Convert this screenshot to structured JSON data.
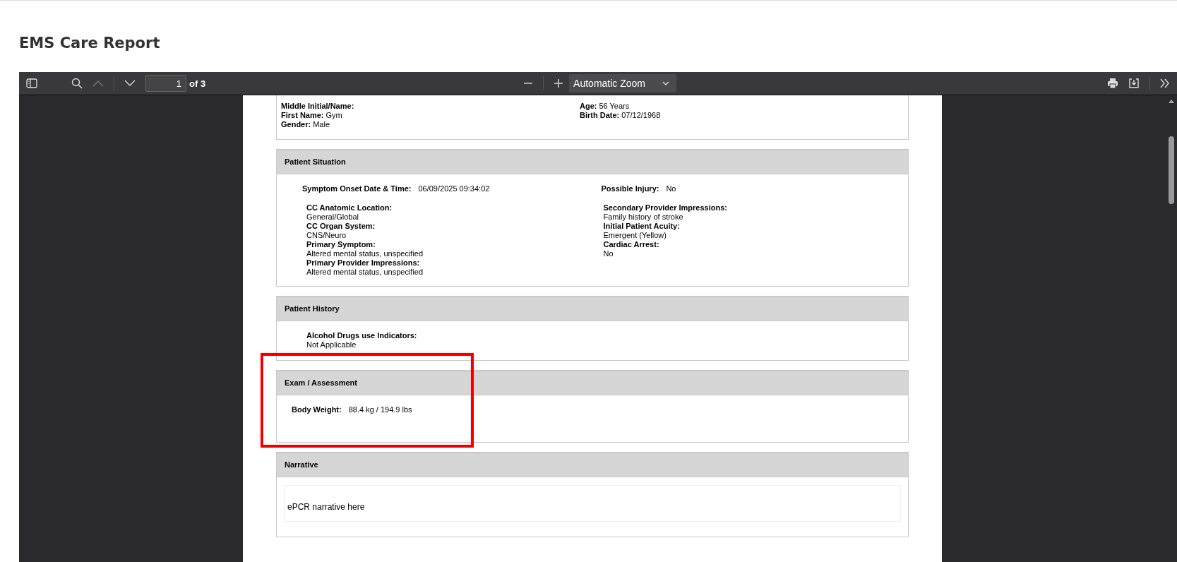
{
  "page_title": "EMS Care Report",
  "toolbar": {
    "page_number": "1",
    "page_count": "of 3",
    "zoom": "Automatic Zoom"
  },
  "demographics": {
    "left": [
      {
        "label": "Middle Initial/Name:"
      },
      {
        "label": "First Name:",
        "value": "Gym"
      },
      {
        "label": "Gender:",
        "value": "Male"
      }
    ],
    "right": [
      {
        "label": "Age:",
        "value": "56 Years"
      },
      {
        "label": "Birth Date:",
        "value": "07/12/1968"
      }
    ]
  },
  "sections": [
    {
      "title": "Patient Situation",
      "kind": "situation",
      "highlighted": false,
      "inline_fields": [
        {
          "label": "Symptom Onset Date & Time:",
          "value": "06/09/2025 09:34:02"
        },
        {
          "label": "Possible Injury:",
          "value": "No"
        }
      ],
      "columns": [
        [
          {
            "label": "CC Anatomic Location:",
            "value": "General/Global"
          },
          {
            "label": "CC Organ System:",
            "value": "CNS/Neuro"
          },
          {
            "label": "Primary Symptom:",
            "value": "Altered mental status, unspecified"
          },
          {
            "label": "Primary Provider Impressions:",
            "value": "Altered mental status, unspecified"
          }
        ],
        [
          {
            "label": "Secondary Provider Impressions:",
            "value": "Family history of stroke"
          },
          {
            "label": "Initial Patient Acuity:",
            "value": "Emergent (Yellow)"
          },
          {
            "label": "Cardiac Arrest:",
            "value": "No"
          }
        ]
      ]
    },
    {
      "title": "Patient History",
      "kind": "stacked",
      "highlighted": false,
      "columns": [
        [
          {
            "label": "Alcohol Drugs use Indicators:",
            "value": "Not Applicable"
          }
        ]
      ]
    },
    {
      "title": "Exam / Assessment",
      "kind": "inline",
      "highlighted": true,
      "inline_fields": [
        {
          "label": "Body Weight:",
          "value": "88.4 kg / 194.9 lbs"
        }
      ]
    },
    {
      "title": "Narrative",
      "kind": "narrative",
      "highlighted": false,
      "narrative": "ePCR narrative here"
    }
  ]
}
